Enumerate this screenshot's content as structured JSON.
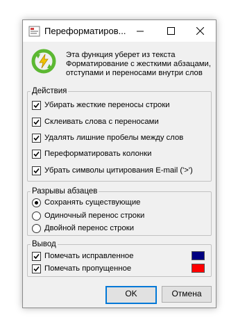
{
  "window": {
    "title": "Переформатиров..."
  },
  "description": [
    "Эта функция уберет из текста",
    "Форматирование с жесткими абзацами,",
    "отступами и переносами внутри слов"
  ],
  "actions": {
    "legend": "Действия",
    "items": [
      {
        "label": "Убирать жесткие переносы строки",
        "checked": true
      },
      {
        "label": "Склеивать слова с переносами",
        "checked": true
      },
      {
        "label": "Удалять лишние пробелы между слов",
        "checked": true
      },
      {
        "label": "Переформатировать колонки",
        "checked": true
      },
      {
        "label": "Убрать символы цитирования E-mail ('>')",
        "checked": true
      }
    ]
  },
  "breaks": {
    "legend": "Разрывы абзацев",
    "options": [
      {
        "label": "Сохранять существующие",
        "selected": true
      },
      {
        "label": "Одиночный перенос строки",
        "selected": false
      },
      {
        "label": "Двойной перенос строки",
        "selected": false
      }
    ]
  },
  "output": {
    "legend": "Вывод",
    "items": [
      {
        "label": "Помечать исправленное",
        "checked": true,
        "color": "#000080"
      },
      {
        "label": "Помечать пропущенное",
        "checked": true,
        "color": "#ff0000"
      }
    ]
  },
  "buttons": {
    "ok": "OK",
    "cancel": "Отмена"
  }
}
